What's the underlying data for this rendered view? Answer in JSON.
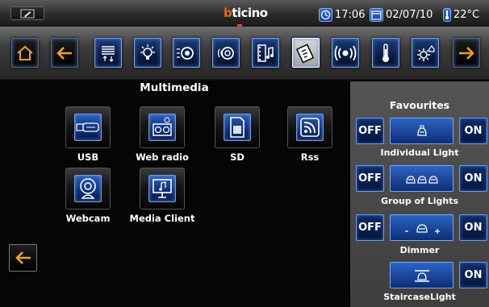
{
  "status": {
    "logo_b": "b",
    "logo_rest": "ticino",
    "time": "17:06",
    "date": "02/07/10",
    "temperature": "22°C"
  },
  "toolbar": {
    "buttons": [
      "home-icon",
      "back-arrow-icon",
      "shutter-icon",
      "lighting-icon",
      "scenario-icon",
      "sound-icon",
      "multimedia-icon",
      "energy-icon",
      "answering-icon",
      "temperature-icon",
      "settings-icon",
      "forward-arrow-icon"
    ]
  },
  "main": {
    "title": "Multimedia",
    "items": [
      {
        "label": "USB",
        "icon": "usb-icon"
      },
      {
        "label": "Web radio",
        "icon": "web-radio-icon"
      },
      {
        "label": "SD",
        "icon": "sd-card-icon"
      },
      {
        "label": "Rss",
        "icon": "rss-icon"
      },
      {
        "label": "Webcam",
        "icon": "webcam-icon"
      },
      {
        "label": "Media Client",
        "icon": "media-client-icon"
      }
    ]
  },
  "favourites": {
    "title": "Favourites",
    "off_label": "OFF",
    "on_label": "ON",
    "items": [
      {
        "label": "Individual Light"
      },
      {
        "label": "Group of Lights"
      },
      {
        "label": "Dimmer"
      },
      {
        "label": "StaircaseLight"
      }
    ]
  },
  "colors": {
    "accent_orange": "#f0a020",
    "tile_blue": "#2b5fb8",
    "logo_orange": "#e8651a"
  }
}
